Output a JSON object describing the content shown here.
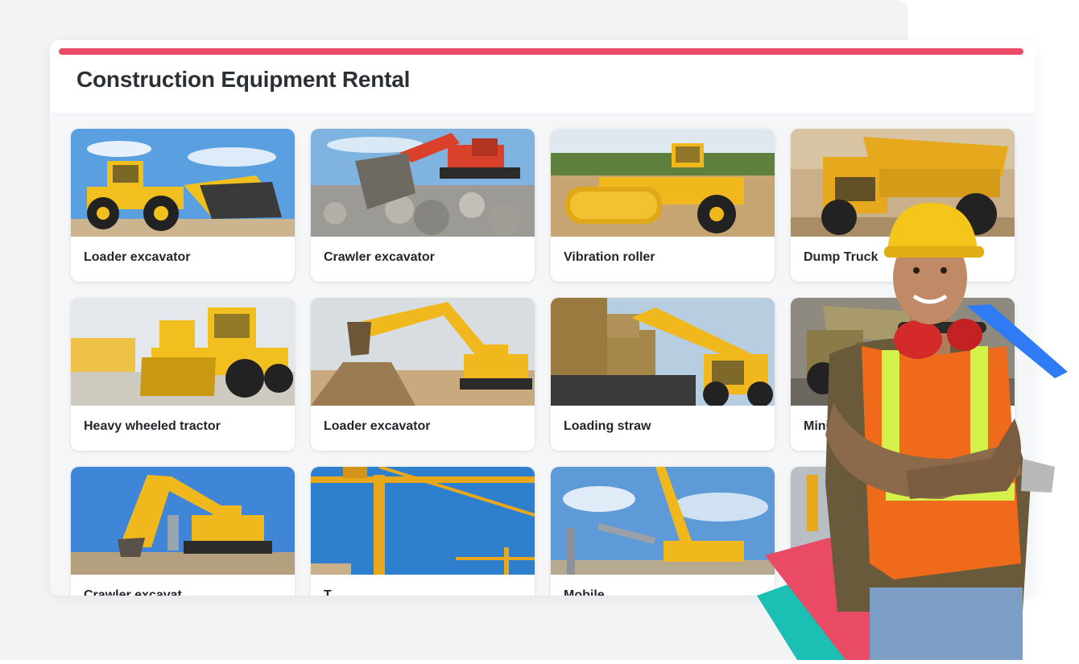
{
  "app": {
    "title": "Construction Equipment Rental",
    "accent_color": "#e94a64"
  },
  "equipment": [
    {
      "label": "Loader excavator",
      "icon": "wheel-loader-photo"
    },
    {
      "label": "Crawler excavator",
      "icon": "crawler-excavator-photo"
    },
    {
      "label": "Vibration roller",
      "icon": "vibration-roller-photo"
    },
    {
      "label": "Dump Truck",
      "icon": "dump-truck-photo"
    },
    {
      "label": "Heavy wheeled tractor",
      "icon": "wheeled-tractor-photo"
    },
    {
      "label": "Loader excavator",
      "icon": "excavator-photo"
    },
    {
      "label": "Loading straw",
      "icon": "telehandler-photo"
    },
    {
      "label": "Mini",
      "icon": "mining-truck-photo"
    },
    {
      "label": "Crawler excavat",
      "icon": "crawler-excavator-photo"
    },
    {
      "label": "T",
      "icon": "tower-crane-photo"
    },
    {
      "label": "Mobile",
      "icon": "mobile-crane-photo"
    },
    {
      "label": "",
      "icon": "crane-photo"
    }
  ],
  "overlay": {
    "icon": "construction-worker-image",
    "decor_colors": [
      "#e94a64",
      "#1bbfb3",
      "#8a4fd6",
      "#2f7bf5"
    ]
  }
}
